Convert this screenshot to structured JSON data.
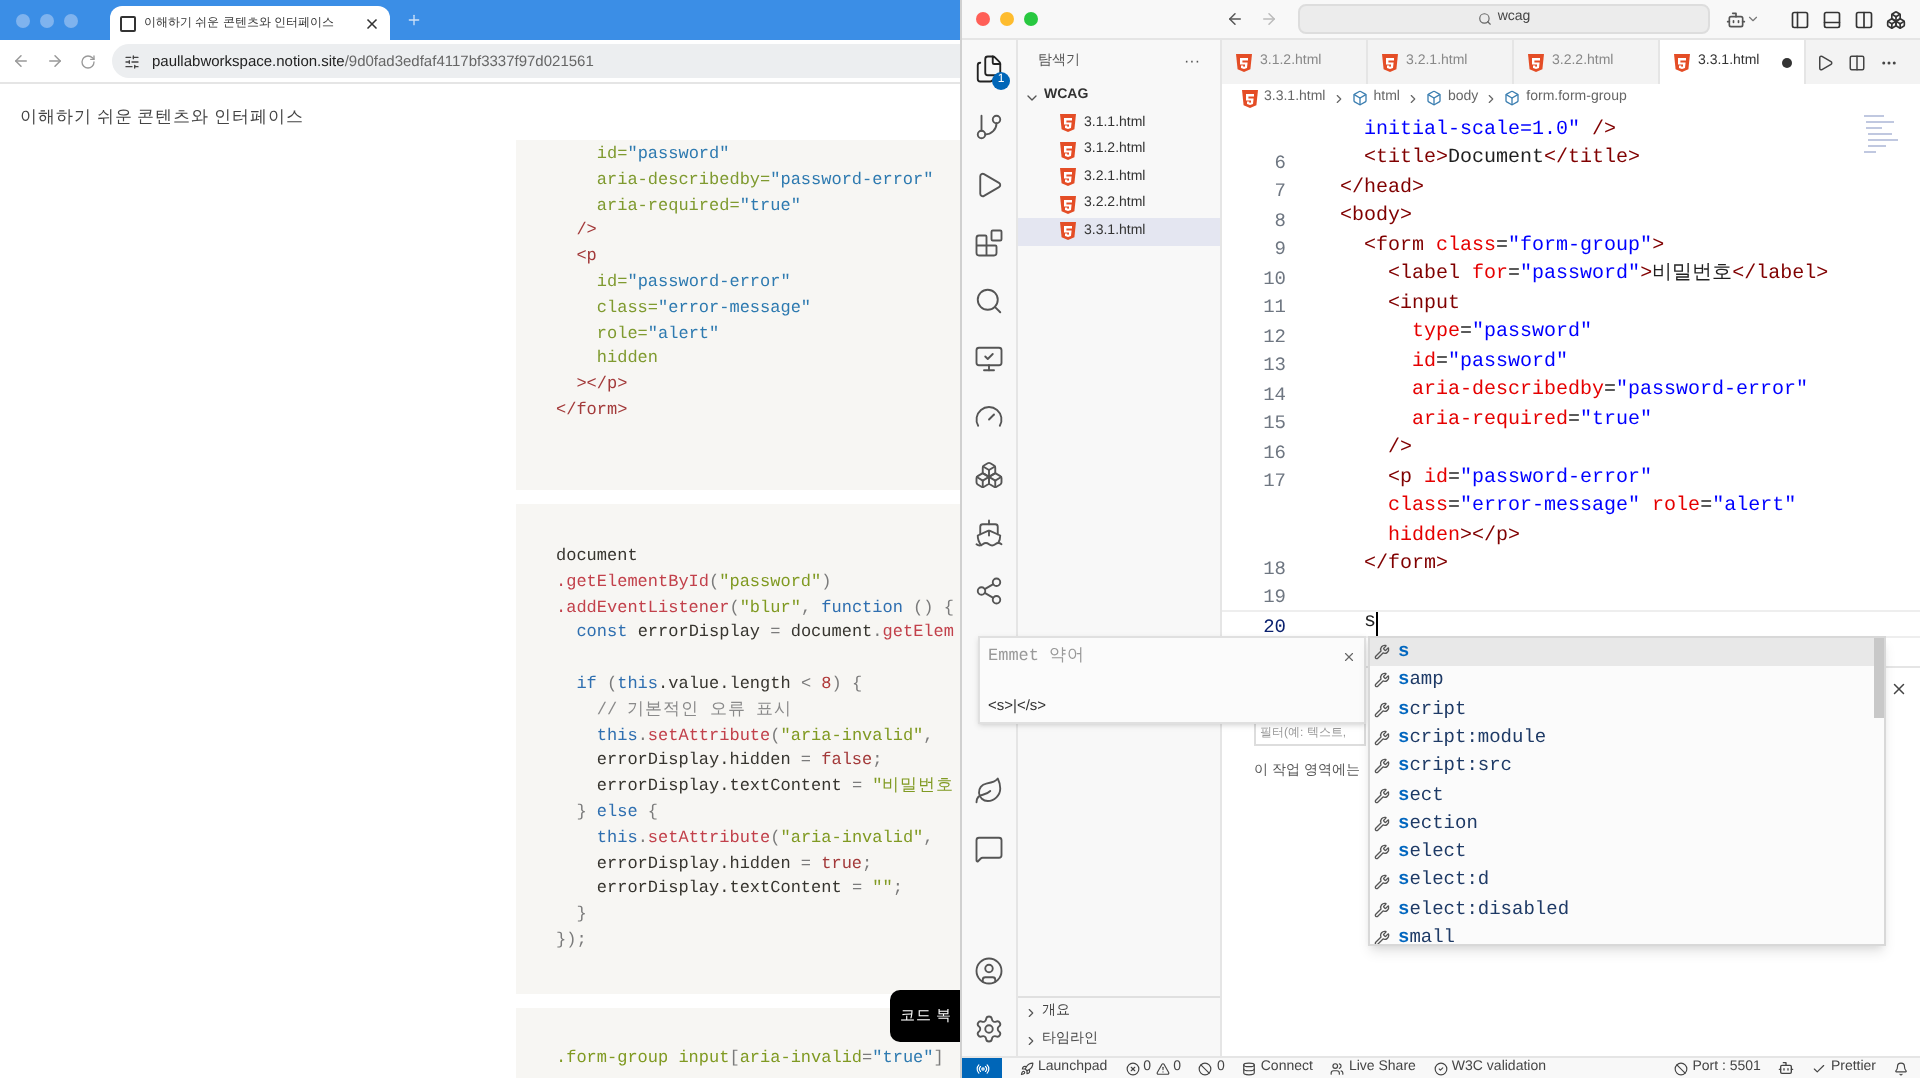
{
  "browser": {
    "tab_title": "이해하기 쉬운 콘텐츠와 인터페이스",
    "url": {
      "host": "paullabworkspace.notion.site",
      "path": "/9d0fad3edfaf4117bf3337f97d021561"
    },
    "page_title": "이해하기 쉬운 콘텐츠와 인터페이스",
    "code_blocks": [
      {
        "groups": [
          [
            [
              {
                "kind": "attr",
                "text": "    id="
              },
              {
                "kind": "value",
                "text": "\"password\""
              }
            ],
            [
              {
                "kind": "attr",
                "text": "    aria-describedby="
              },
              {
                "kind": "value",
                "text": "\"password-error\""
              }
            ],
            [
              {
                "kind": "attr",
                "text": "    aria-required="
              },
              {
                "kind": "value",
                "text": "\"true\""
              }
            ],
            [
              {
                "kind": "tag",
                "text": "  />"
              }
            ],
            [
              {
                "kind": "tag",
                "text": "  <p"
              }
            ],
            [
              {
                "kind": "attr",
                "text": "    id="
              },
              {
                "kind": "value",
                "text": "\"password-error\""
              }
            ],
            [
              {
                "kind": "attr",
                "text": "    class="
              },
              {
                "kind": "value",
                "text": "\"error-message\""
              }
            ],
            [
              {
                "kind": "attr",
                "text": "    role="
              },
              {
                "kind": "value",
                "text": "\"alert\""
              }
            ],
            [
              {
                "kind": "attr",
                "text": "    hidden"
              }
            ],
            [
              {
                "kind": "tag",
                "text": "  ></p>"
              }
            ],
            [
              {
                "kind": "tag",
                "text": "</form>"
              }
            ]
          ]
        ]
      },
      {
        "groups": [
          [
            [
              {
                "kind": "plain",
                "text": "document"
              }
            ],
            [
              {
                "kind": "fn",
                "text": ".getElementById"
              },
              {
                "kind": "punct",
                "text": "("
              },
              {
                "kind": "string",
                "text": "\"password\""
              },
              {
                "kind": "punct",
                "text": ")"
              }
            ],
            [
              {
                "kind": "fn",
                "text": ".addEventListener"
              },
              {
                "kind": "punct",
                "text": "("
              },
              {
                "kind": "string",
                "text": "\"blur\""
              },
              {
                "kind": "punct",
                "text": ", "
              },
              {
                "kind": "keyword",
                "text": "function"
              },
              {
                "kind": "punct",
                "text": " () {"
              }
            ],
            [
              {
                "kind": "keyword",
                "text": "  const"
              },
              {
                "kind": "plain",
                "text": " errorDisplay "
              },
              {
                "kind": "punct",
                "text": "="
              },
              {
                "kind": "plain",
                "text": " document"
              },
              {
                "kind": "punct",
                "text": "."
              },
              {
                "kind": "fn",
                "text": "getElem"
              }
            ]
          ],
          [
            [
              {
                "kind": "keyword",
                "text": "  if"
              },
              {
                "kind": "punct",
                "text": " ("
              },
              {
                "kind": "keyword",
                "text": "this"
              },
              {
                "kind": "plain",
                "text": ".value.length "
              },
              {
                "kind": "punct",
                "text": "<"
              },
              {
                "kind": "number",
                "text": " 8"
              },
              {
                "kind": "punct",
                "text": ") {"
              }
            ],
            [
              {
                "kind": "comment",
                "text": "    // 기본적인 오류 표시"
              }
            ],
            [
              {
                "kind": "keyword",
                "text": "    this"
              },
              {
                "kind": "punct",
                "text": "."
              },
              {
                "kind": "fn",
                "text": "setAttribute"
              },
              {
                "kind": "punct",
                "text": "("
              },
              {
                "kind": "string",
                "text": "\"aria-invalid\""
              },
              {
                "kind": "punct",
                "text": ","
              }
            ],
            [
              {
                "kind": "plain",
                "text": "    errorDisplay.hidden "
              },
              {
                "kind": "punct",
                "text": "="
              },
              {
                "kind": "bool",
                "text": " false"
              },
              {
                "kind": "punct",
                "text": ";"
              }
            ],
            [
              {
                "kind": "plain",
                "text": "    errorDisplay.textContent "
              },
              {
                "kind": "punct",
                "text": "="
              },
              {
                "kind": "string",
                "text": " \"비밀번호"
              }
            ],
            [
              {
                "kind": "punct",
                "text": "  } "
              },
              {
                "kind": "keyword",
                "text": "else"
              },
              {
                "kind": "punct",
                "text": " {"
              }
            ],
            [
              {
                "kind": "keyword",
                "text": "    this"
              },
              {
                "kind": "punct",
                "text": "."
              },
              {
                "kind": "fn",
                "text": "setAttribute"
              },
              {
                "kind": "punct",
                "text": "("
              },
              {
                "kind": "string",
                "text": "\"aria-invalid\""
              },
              {
                "kind": "punct",
                "text": ","
              }
            ],
            [
              {
                "kind": "plain",
                "text": "    errorDisplay.hidden "
              },
              {
                "kind": "punct",
                "text": "="
              },
              {
                "kind": "bool",
                "text": " true"
              },
              {
                "kind": "punct",
                "text": ";"
              }
            ],
            [
              {
                "kind": "plain",
                "text": "    errorDisplay.textContent "
              },
              {
                "kind": "punct",
                "text": "="
              },
              {
                "kind": "string",
                "text": " \"\""
              },
              {
                "kind": "punct",
                "text": ";"
              }
            ],
            [
              {
                "kind": "punct",
                "text": "  }"
              }
            ],
            [
              {
                "kind": "punct",
                "text": "});"
              }
            ]
          ]
        ]
      },
      {
        "groups": [
          [
            [
              {
                "kind": "string",
                "text": ".form-group input"
              },
              {
                "kind": "punct",
                "text": "["
              },
              {
                "kind": "string",
                "text": "aria-invalid"
              },
              {
                "kind": "punct",
                "text": "="
              },
              {
                "kind": "value",
                "text": "\"true\""
              },
              {
                "kind": "punct",
                "text": "]"
              }
            ]
          ]
        ]
      }
    ],
    "tooltip": "코드 복"
  },
  "vscode": {
    "search": "wcag",
    "explorer_badge": "1",
    "sidebar": {
      "title": "탐색기",
      "more": "···",
      "folder": "WCAG",
      "files": [
        {
          "name": "3.1.1.html",
          "selected": false
        },
        {
          "name": "3.1.2.html",
          "selected": false
        },
        {
          "name": "3.2.1.html",
          "selected": false
        },
        {
          "name": "3.2.2.html",
          "selected": false
        },
        {
          "name": "3.3.1.html",
          "selected": true
        }
      ],
      "sections": [
        "개요",
        "타임라인"
      ]
    },
    "tabs": [
      {
        "label": "3.1.2.html",
        "selected": false,
        "modified": false
      },
      {
        "label": "3.2.1.html",
        "selected": false,
        "modified": false
      },
      {
        "label": "3.2.2.html",
        "selected": false,
        "modified": false
      },
      {
        "label": "3.3.1.html",
        "selected": true,
        "modified": true
      }
    ],
    "breadcrumb": [
      "3.3.1.html",
      "html",
      "body",
      "form.form-group"
    ],
    "lines": [
      {
        "current": false,
        "tokens": [
          {
            "kind": "value",
            "text": "  initial-scale=1.0\""
          },
          {
            "kind": "tag",
            "text": " />"
          }
        ]
      },
      {
        "number": "6",
        "current": false,
        "tokens": [
          {
            "kind": "tag",
            "text": "  <title>"
          },
          {
            "kind": "plain",
            "text": "Document"
          },
          {
            "kind": "tag",
            "text": "</title>"
          }
        ]
      },
      {
        "number": "7",
        "current": false,
        "tokens": [
          {
            "kind": "tag",
            "text": "</head>"
          }
        ]
      },
      {
        "number": "8",
        "current": false,
        "tokens": [
          {
            "kind": "tag",
            "text": "<body>"
          }
        ]
      },
      {
        "number": "9",
        "current": false,
        "tokens": [
          {
            "kind": "tag",
            "text": "  <form "
          },
          {
            "kind": "attr",
            "text": "class"
          },
          {
            "kind": "plain",
            "text": "="
          },
          {
            "kind": "value",
            "text": "\"form-group\""
          },
          {
            "kind": "tag",
            "text": ">"
          }
        ]
      },
      {
        "number": "10",
        "current": false,
        "tokens": [
          {
            "kind": "tag",
            "text": "    <label "
          },
          {
            "kind": "attr",
            "text": "for"
          },
          {
            "kind": "plain",
            "text": "="
          },
          {
            "kind": "value",
            "text": "\"password\""
          },
          {
            "kind": "tag",
            "text": ">"
          },
          {
            "kind": "plain",
            "text": "비밀번호"
          },
          {
            "kind": "tag",
            "text": "</label>"
          }
        ]
      },
      {
        "number": "11",
        "current": false,
        "tokens": [
          {
            "kind": "tag",
            "text": "    <input"
          }
        ]
      },
      {
        "number": "12",
        "current": false,
        "tokens": [
          {
            "kind": "attr",
            "text": "      type"
          },
          {
            "kind": "plain",
            "text": "="
          },
          {
            "kind": "value",
            "text": "\"password\""
          }
        ]
      },
      {
        "number": "13",
        "current": false,
        "tokens": [
          {
            "kind": "attr",
            "text": "      id"
          },
          {
            "kind": "plain",
            "text": "="
          },
          {
            "kind": "value",
            "text": "\"password\""
          }
        ]
      },
      {
        "number": "14",
        "current": false,
        "tokens": [
          {
            "kind": "attr",
            "text": "      aria-describedby"
          },
          {
            "kind": "plain",
            "text": "="
          },
          {
            "kind": "value",
            "text": "\"password-error\""
          }
        ]
      },
      {
        "number": "15",
        "current": false,
        "tokens": [
          {
            "kind": "attr",
            "text": "      aria-required"
          },
          {
            "kind": "plain",
            "text": "="
          },
          {
            "kind": "value",
            "text": "\"true\""
          }
        ]
      },
      {
        "number": "16",
        "current": false,
        "tokens": [
          {
            "kind": "tag",
            "text": "    />"
          }
        ]
      },
      {
        "number": "17",
        "current": false,
        "tokens": [
          {
            "kind": "tag",
            "text": "    <p "
          },
          {
            "kind": "attr",
            "text": "id"
          },
          {
            "kind": "plain",
            "text": "="
          },
          {
            "kind": "value",
            "text": "\"password-error\""
          }
        ]
      },
      {
        "current": false,
        "tokens": [
          {
            "kind": "attr",
            "text": "    class"
          },
          {
            "kind": "plain",
            "text": "="
          },
          {
            "kind": "value",
            "text": "\"error-message\" "
          },
          {
            "kind": "attr",
            "text": "role"
          },
          {
            "kind": "plain",
            "text": "="
          },
          {
            "kind": "value",
            "text": "\"alert\""
          }
        ]
      },
      {
        "current": false,
        "tokens": [
          {
            "kind": "attr",
            "text": "    hidden"
          },
          {
            "kind": "tag",
            "text": "></p>"
          }
        ]
      },
      {
        "number": "18",
        "current": false,
        "tokens": [
          {
            "kind": "tag",
            "text": "  </form>"
          }
        ]
      },
      {
        "number": "19",
        "current": false
      },
      {
        "number": "20",
        "current": true,
        "tokens": [
          {
            "kind": "plain",
            "text": "  s"
          }
        ]
      }
    ],
    "emmet": {
      "title": "Emmet 약어",
      "preview": "<s>|</s>"
    },
    "suggestions": [
      {
        "match": "s",
        "selected": true
      },
      {
        "match": "s",
        "rest": "amp",
        "selected": false
      },
      {
        "match": "s",
        "rest": "cript",
        "selected": false
      },
      {
        "match": "s",
        "rest": "cript:module",
        "selected": false
      },
      {
        "match": "s",
        "rest": "cript:src",
        "selected": false
      },
      {
        "match": "s",
        "rest": "ect",
        "selected": false
      },
      {
        "match": "s",
        "rest": "ection",
        "selected": false
      },
      {
        "match": "s",
        "rest": "elect",
        "selected": false
      },
      {
        "match": "s",
        "rest": "elect:d",
        "selected": false
      },
      {
        "match": "s",
        "rest": "elect:disabled",
        "selected": false
      },
      {
        "match": "s",
        "rest": "mall",
        "selected": false
      }
    ],
    "panel": {
      "filter_placeholder": "필터(예: 텍스트,",
      "message": "이 작업 영역에는"
    },
    "status_bar": {
      "launchpad": "Launchpad",
      "errors": "0",
      "warnings": "0",
      "ports": "0",
      "connect": "Connect",
      "live_share": "Live Share",
      "w3c": "W3C validation",
      "port": "Port : 5501",
      "prettier": "Prettier"
    }
  }
}
